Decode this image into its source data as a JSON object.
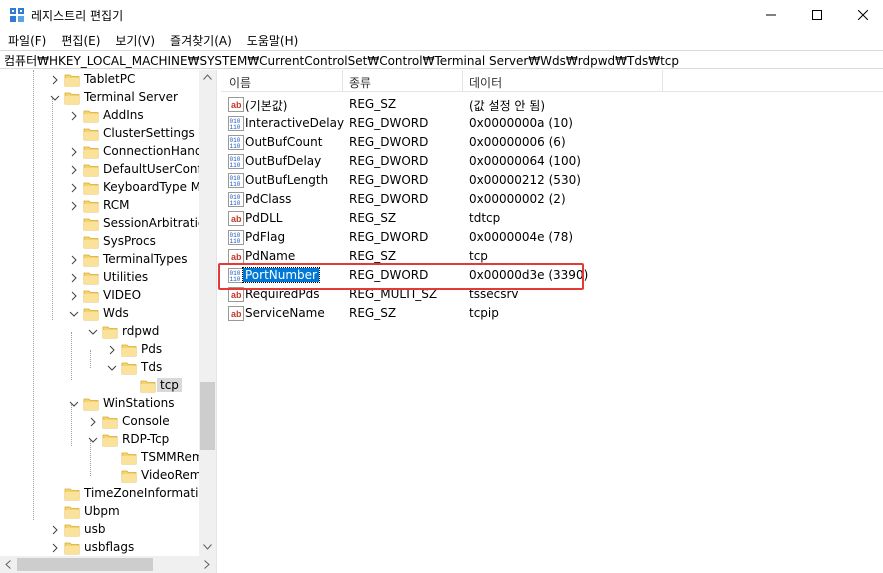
{
  "window": {
    "title": "레지스트리 편집기",
    "icon": "regedit-icon"
  },
  "menu": [
    "파일(F)",
    "편집(E)",
    "보기(V)",
    "즐겨찾기(A)",
    "도움말(H)"
  ],
  "address": "컴퓨터₩HKEY_LOCAL_MACHINE₩SYSTEM₩CurrentControlSet₩Control₩Terminal Server₩Wds₩rdpwd₩Tds₩tcp",
  "tree": [
    {
      "label": "TabletPC",
      "expand": "right"
    },
    {
      "label": "Terminal Server",
      "expand": "down"
    },
    {
      "label": "AddIns",
      "expand": "right"
    },
    {
      "label": "ClusterSettings",
      "expand": "none"
    },
    {
      "label": "ConnectionHandler",
      "expand": "right"
    },
    {
      "label": "DefaultUserConfiguration",
      "expand": "right"
    },
    {
      "label": "KeyboardType Mapping",
      "expand": "right"
    },
    {
      "label": "RCM",
      "expand": "right"
    },
    {
      "label": "SessionArbitrationHelper",
      "expand": "none"
    },
    {
      "label": "SysProcs",
      "expand": "none"
    },
    {
      "label": "TerminalTypes",
      "expand": "right"
    },
    {
      "label": "Utilities",
      "expand": "right"
    },
    {
      "label": "VIDEO",
      "expand": "right"
    },
    {
      "label": "Wds",
      "expand": "down"
    },
    {
      "label": "rdpwd",
      "expand": "down"
    },
    {
      "label": "Pds",
      "expand": "right"
    },
    {
      "label": "Tds",
      "expand": "down"
    },
    {
      "label": "tcp",
      "expand": "none",
      "selected": true
    },
    {
      "label": "WinStations",
      "expand": "down"
    },
    {
      "label": "Console",
      "expand": "right"
    },
    {
      "label": "RDP-Tcp",
      "expand": "down"
    },
    {
      "label": "TSMMRemotingAllowedApps",
      "expand": "none"
    },
    {
      "label": "VideoRemotingAllowedApps",
      "expand": "none"
    },
    {
      "label": "TimeZoneInformation",
      "expand": "none"
    },
    {
      "label": "Ubpm",
      "expand": "none"
    },
    {
      "label": "usb",
      "expand": "right"
    },
    {
      "label": "usbflags",
      "expand": "right"
    }
  ],
  "list": {
    "headers": {
      "name": "이름",
      "type": "종류",
      "data": "데이터"
    },
    "rows": [
      {
        "name": "(기본값)",
        "type": "REG_SZ",
        "data": "(값 설정 안 됨)",
        "icon": "string-value-icon"
      },
      {
        "name": "InteractiveDelay",
        "type": "REG_DWORD",
        "data": "0x0000000a (10)",
        "icon": "binary-value-icon"
      },
      {
        "name": "OutBufCount",
        "type": "REG_DWORD",
        "data": "0x00000006 (6)",
        "icon": "binary-value-icon"
      },
      {
        "name": "OutBufDelay",
        "type": "REG_DWORD",
        "data": "0x00000064 (100)",
        "icon": "binary-value-icon"
      },
      {
        "name": "OutBufLength",
        "type": "REG_DWORD",
        "data": "0x00000212 (530)",
        "icon": "binary-value-icon"
      },
      {
        "name": "PdClass",
        "type": "REG_DWORD",
        "data": "0x00000002 (2)",
        "icon": "binary-value-icon"
      },
      {
        "name": "PdDLL",
        "type": "REG_SZ",
        "data": "tdtcp",
        "icon": "string-value-icon"
      },
      {
        "name": "PdFlag",
        "type": "REG_DWORD",
        "data": "0x0000004e (78)",
        "icon": "binary-value-icon"
      },
      {
        "name": "PdName",
        "type": "REG_SZ",
        "data": "tcp",
        "icon": "string-value-icon"
      },
      {
        "name": "PortNumber",
        "type": "REG_DWORD",
        "data": "0x00000d3e (3390)",
        "icon": "binary-value-icon",
        "selected": true
      },
      {
        "name": "RequiredPds",
        "type": "REG_MULTI_SZ",
        "data": "tssecsrv",
        "icon": "string-value-icon"
      },
      {
        "name": "ServiceName",
        "type": "REG_SZ",
        "data": "tcpip",
        "icon": "string-value-icon"
      }
    ]
  },
  "colors": {
    "selection": "#0078d7",
    "annotation": "#e53935",
    "folder": "#f6d36b"
  }
}
